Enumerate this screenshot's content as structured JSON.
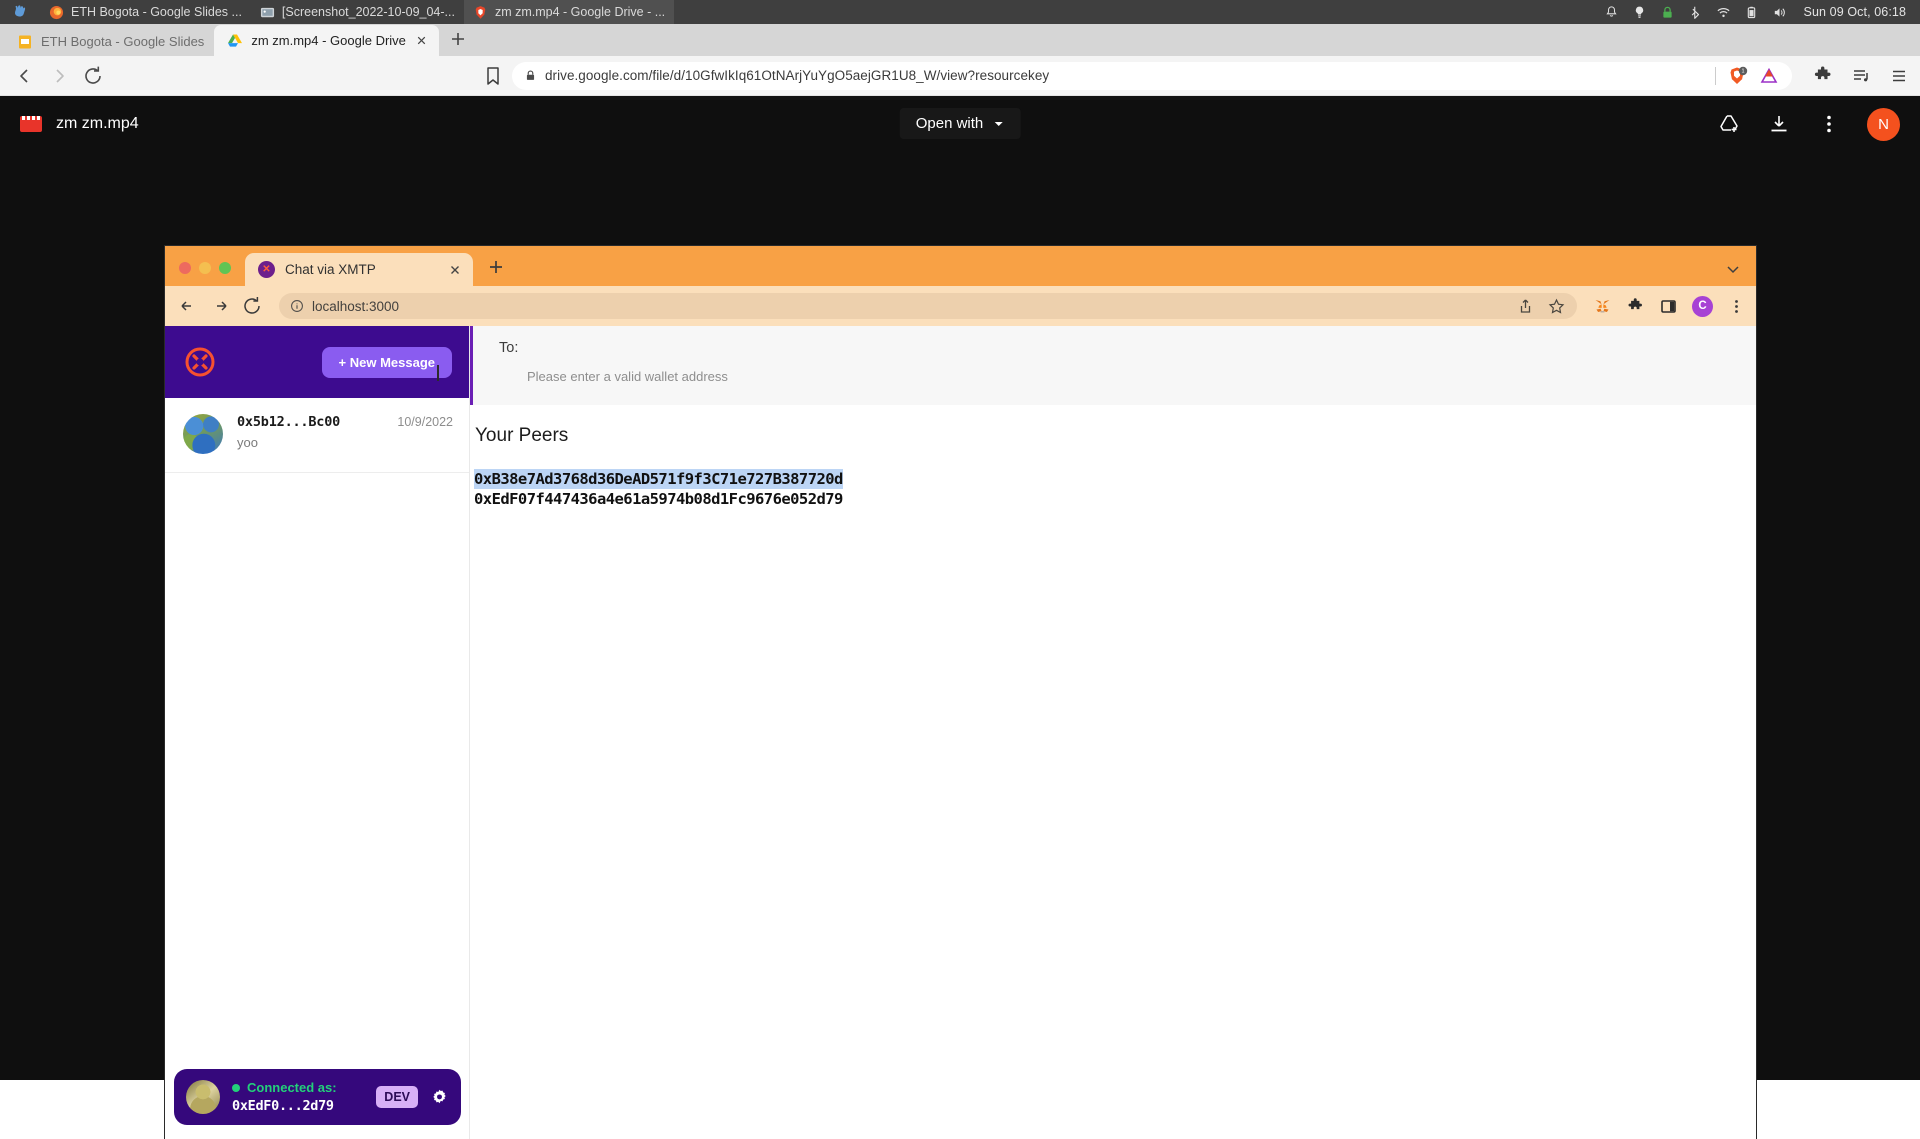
{
  "os_bar": {
    "activities_icon": "activities-icon",
    "tasks": [
      {
        "icon": "firefox-icon",
        "label": "ETH Bogota - Google Slides ...",
        "active": false
      },
      {
        "icon": "image-viewer-icon",
        "label": "[Screenshot_2022-10-09_04-...",
        "active": false
      },
      {
        "icon": "brave-icon",
        "label": "zm zm.mp4 - Google Drive - ...",
        "active": true
      }
    ],
    "tray_icons": [
      "bell-icon",
      "lightbulb-icon",
      "lock-icon",
      "bluetooth-icon",
      "wifi-icon",
      "battery-icon",
      "volume-icon"
    ],
    "clock": "Sun 09 Oct, 06:18"
  },
  "brave": {
    "tabs": [
      {
        "favicon": "slides-icon",
        "title": "ETH Bogota - Google Slides",
        "active": false,
        "close": "close-icon"
      },
      {
        "favicon": "drive-icon",
        "title": "zm zm.mp4 - Google Drive",
        "active": true,
        "close": "close-icon"
      }
    ],
    "new_tab_label": "+",
    "nav": {
      "back": "back-arrow-icon",
      "forward": "forward-arrow-icon",
      "reload": "reload-icon",
      "bookmark": "bookmark-icon"
    },
    "omnibox": {
      "lock_icon": "lock-icon",
      "url": "drive.google.com/file/d/10GfwIkIq61OtNArjYuYgO5aejGR1U8_W/view?resourcekey",
      "shield_icon": "brave-shield-icon",
      "shield_badge": "1",
      "rewards_icon": "brave-rewards-triangle-icon"
    },
    "toolbar_icons": [
      "extensions-puzzle-icon",
      "playlist-icon",
      "hamburger-menu-icon"
    ]
  },
  "drive": {
    "file_icon": "video-file-icon",
    "file_name": "zm zm.mp4",
    "open_with": {
      "label": "Open with",
      "chevron": "chevron-down-icon"
    },
    "actions": [
      "add-to-drive-icon",
      "download-icon",
      "more-options-icon"
    ],
    "avatar_initial": "N",
    "avatar_color": "#f4511e"
  },
  "inner_browser": {
    "theme_color": "#f8a145",
    "window_buttons": [
      "close-window-button",
      "minimize-window-button",
      "maximize-window-button"
    ],
    "tab": {
      "favicon": "xmtp-favicon",
      "title": "Chat via XMTP",
      "close": "close-icon"
    },
    "new_tab": "+",
    "tabstrip_chevron": "chevron-down-icon",
    "nav": {
      "back": "back-arrow-icon",
      "forward": "forward-arrow-icon",
      "reload": "reload-icon"
    },
    "omnibox": {
      "info_icon": "info-circle-icon",
      "url": "localhost:3000",
      "share_icon": "share-icon",
      "star_icon": "star-icon"
    },
    "toolbar_icons": [
      "metamask-fox-icon",
      "extensions-puzzle-icon",
      "side-panel-icon"
    ],
    "avatar_initial": "C",
    "avatar_color": "#a742d4",
    "menu_icon": "kebab-menu-icon"
  },
  "app": {
    "sidebar": {
      "logo": "xmtp-logo-icon",
      "new_message_label": "+ New Message",
      "conversations": [
        {
          "avatar": "identicon-avatar",
          "address": "0x5b12...Bc00",
          "date": "10/9/2022",
          "preview": "yoo"
        }
      ],
      "connected": {
        "avatar": "wallet-avatar",
        "status_dot": "online-dot",
        "status_label": "Connected as:",
        "address": "0xEdF0...2d79",
        "env_badge": "DEV",
        "settings_icon": "gear-icon"
      }
    },
    "main": {
      "to_label": "To:",
      "to_hint": "Please enter a valid wallet address",
      "peers_title": "Your Peers",
      "peers": [
        {
          "address": "0xB38e7Ad3768d36DeAD571f9f3C71e727B387720d",
          "selected": true
        },
        {
          "address": "0xEdF07f447436a4e61a5974b08d1Fc9676e052d79",
          "selected": false
        }
      ]
    }
  }
}
